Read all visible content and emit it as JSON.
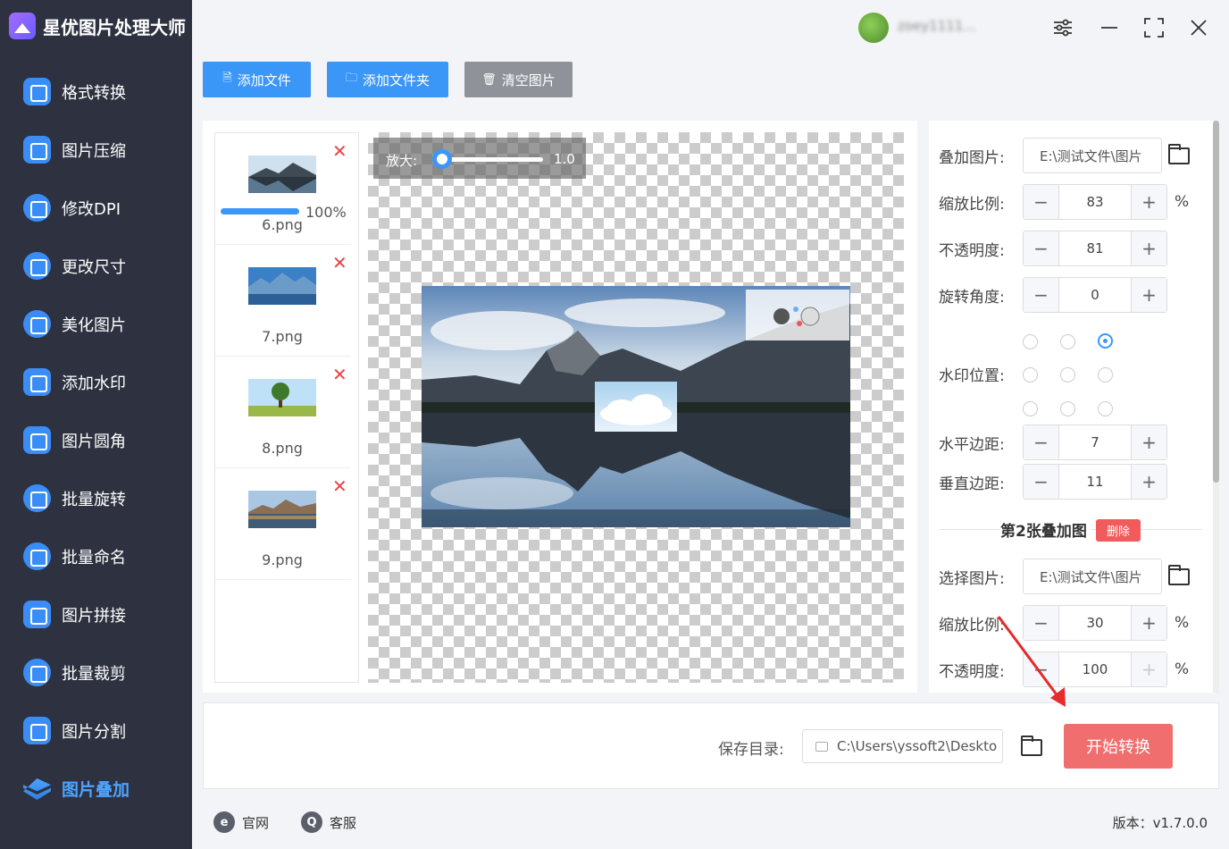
{
  "app": {
    "title": "星优图片处理大师",
    "username": "zoey1111..."
  },
  "sidebar": {
    "items": [
      {
        "label": "格式转换",
        "icon": "image-convert-icon"
      },
      {
        "label": "图片压缩",
        "icon": "compress-icon"
      },
      {
        "label": "修改DPI",
        "icon": "dpi-icon"
      },
      {
        "label": "更改尺寸",
        "icon": "resize-icon"
      },
      {
        "label": "美化图片",
        "icon": "beautify-icon"
      },
      {
        "label": "添加水印",
        "icon": "watermark-icon"
      },
      {
        "label": "图片圆角",
        "icon": "round-corner-icon"
      },
      {
        "label": "批量旋转",
        "icon": "rotate-icon"
      },
      {
        "label": "批量命名",
        "icon": "rename-icon"
      },
      {
        "label": "图片拼接",
        "icon": "puzzle-icon"
      },
      {
        "label": "批量裁剪",
        "icon": "crop-icon"
      },
      {
        "label": "图片分割",
        "icon": "split-icon"
      },
      {
        "label": "图片叠加",
        "icon": "layers-icon",
        "active": true
      }
    ]
  },
  "toolbar": {
    "add_file": "添加文件",
    "add_folder": "添加文件夹",
    "clear": "清空图片"
  },
  "files": [
    {
      "name": "6.png",
      "progress": "100%",
      "progress_value": 1.0
    },
    {
      "name": "7.png"
    },
    {
      "name": "8.png"
    },
    {
      "name": "9.png"
    }
  ],
  "preview": {
    "zoom_label": "放大:",
    "zoom_value": "1.0"
  },
  "settings": {
    "overlay_image_label": "叠加图片:",
    "overlay_image_path": "E:\\测试文件\\图片",
    "scale_label": "缩放比例:",
    "scale_value": "83",
    "scale_unit": "%",
    "opacity_label": "不透明度:",
    "opacity_value": "81",
    "rotate_label": "旋转角度:",
    "rotate_value": "0",
    "position_label": "水印位置:",
    "position_selected": "top-right",
    "hmargin_label": "水平边距:",
    "hmargin_value": "7",
    "vmargin_label": "垂直边距:",
    "vmargin_value": "11",
    "second_title": "第2张叠加图",
    "delete_label": "删除",
    "select_image_label": "选择图片:",
    "second_image_path": "E:\\测试文件\\图片",
    "second_scale_label": "缩放比例:",
    "second_scale_value": "30",
    "second_scale_unit": "%",
    "second_opacity_label": "不透明度:",
    "second_opacity_value": "100",
    "second_opacity_unit": "%"
  },
  "bottom": {
    "save_label": "保存目录:",
    "save_path": "C:\\Users\\yssoft2\\Deskto",
    "start_label": "开始转换"
  },
  "footer": {
    "website": "官网",
    "service": "客服",
    "version": "版本：v1.7.0.0"
  },
  "colors": {
    "sidebar_bg": "#2e3240",
    "accent": "#3b97f7",
    "start_button": "#f06e6e",
    "delete": "#e64545"
  }
}
